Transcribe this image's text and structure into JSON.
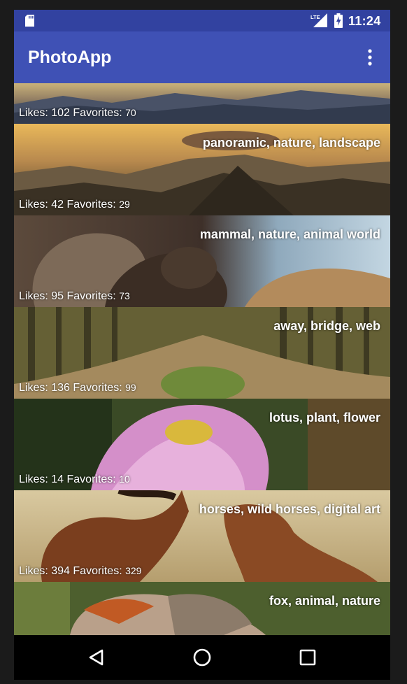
{
  "status_bar": {
    "time": "11:24",
    "network_label": "LTE",
    "background_color": "#3242a0",
    "icons": [
      "sd-card-icon",
      "lte-signal-icon",
      "battery-charging-icon"
    ]
  },
  "app_bar": {
    "title": "PhotoApp",
    "background_color": "#3f51b5",
    "menu_icon": "more-vert-icon"
  },
  "labels": {
    "likes": "Likes:",
    "favorites": "Favorites:"
  },
  "photos": [
    {
      "tags": "",
      "likes": "102",
      "favorites": "70"
    },
    {
      "tags": "panoramic, nature, landscape",
      "likes": "42",
      "favorites": "29"
    },
    {
      "tags": "mammal, nature, animal world",
      "likes": "95",
      "favorites": "73"
    },
    {
      "tags": "away, bridge, web",
      "likes": "136",
      "favorites": "99"
    },
    {
      "tags": "lotus, plant, flower",
      "likes": "14",
      "favorites": "10"
    },
    {
      "tags": "horses, wild horses, digital art",
      "likes": "394",
      "favorites": "329"
    },
    {
      "tags": "fox, animal, nature",
      "likes": "",
      "favorites": ""
    }
  ],
  "nav_bar": {
    "buttons": [
      "back-icon",
      "home-icon",
      "recents-icon"
    ]
  }
}
